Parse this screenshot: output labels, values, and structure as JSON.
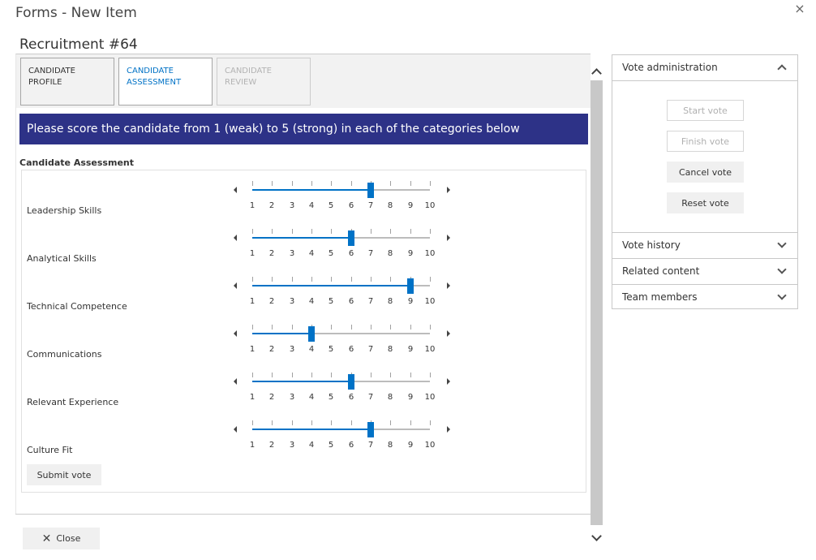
{
  "dialog": {
    "title": "Forms - New Item",
    "close_glyph": "×",
    "close_icon": "close-icon"
  },
  "item": {
    "title": "Recruitment #64"
  },
  "tabs": [
    {
      "label": "CANDIDATE PROFILE",
      "state": "default"
    },
    {
      "label": "CANDIDATE ASSESSMENT",
      "state": "selected"
    },
    {
      "label": "CANDIDATE REVIEW",
      "state": "disabled"
    }
  ],
  "banner": {
    "text": "Please score the candidate from 1 (weak) to 5 (strong) in each of the categories below",
    "color": "#2d3287"
  },
  "assessment": {
    "heading": "Candidate Assessment",
    "scale": {
      "min": 1,
      "max": 10,
      "ticks": [
        "1",
        "2",
        "3",
        "4",
        "5",
        "6",
        "7",
        "8",
        "9",
        "10"
      ]
    },
    "criteria": [
      {
        "label": "Leadership Skills",
        "value": 7
      },
      {
        "label": "Analytical Skills",
        "value": 6
      },
      {
        "label": "Technical Competence",
        "value": 9
      },
      {
        "label": "Communications",
        "value": 4
      },
      {
        "label": "Relevant Experience",
        "value": 6
      },
      {
        "label": "Culture Fit",
        "value": 7
      }
    ],
    "submit_label": "Submit vote",
    "accent_color": "#0072c6"
  },
  "footer": {
    "close_label": "Close",
    "close_glyph": "✕"
  },
  "side_panel": {
    "vote_admin": {
      "title": "Vote administration",
      "expanded": true,
      "buttons": [
        {
          "label": "Start vote",
          "enabled": false
        },
        {
          "label": "Finish vote",
          "enabled": false
        },
        {
          "label": "Cancel vote",
          "enabled": true
        },
        {
          "label": "Reset vote",
          "enabled": true
        }
      ]
    },
    "sections": [
      {
        "title": "Vote history",
        "expanded": false
      },
      {
        "title": "Related content",
        "expanded": false
      },
      {
        "title": "Team members",
        "expanded": false
      }
    ]
  }
}
